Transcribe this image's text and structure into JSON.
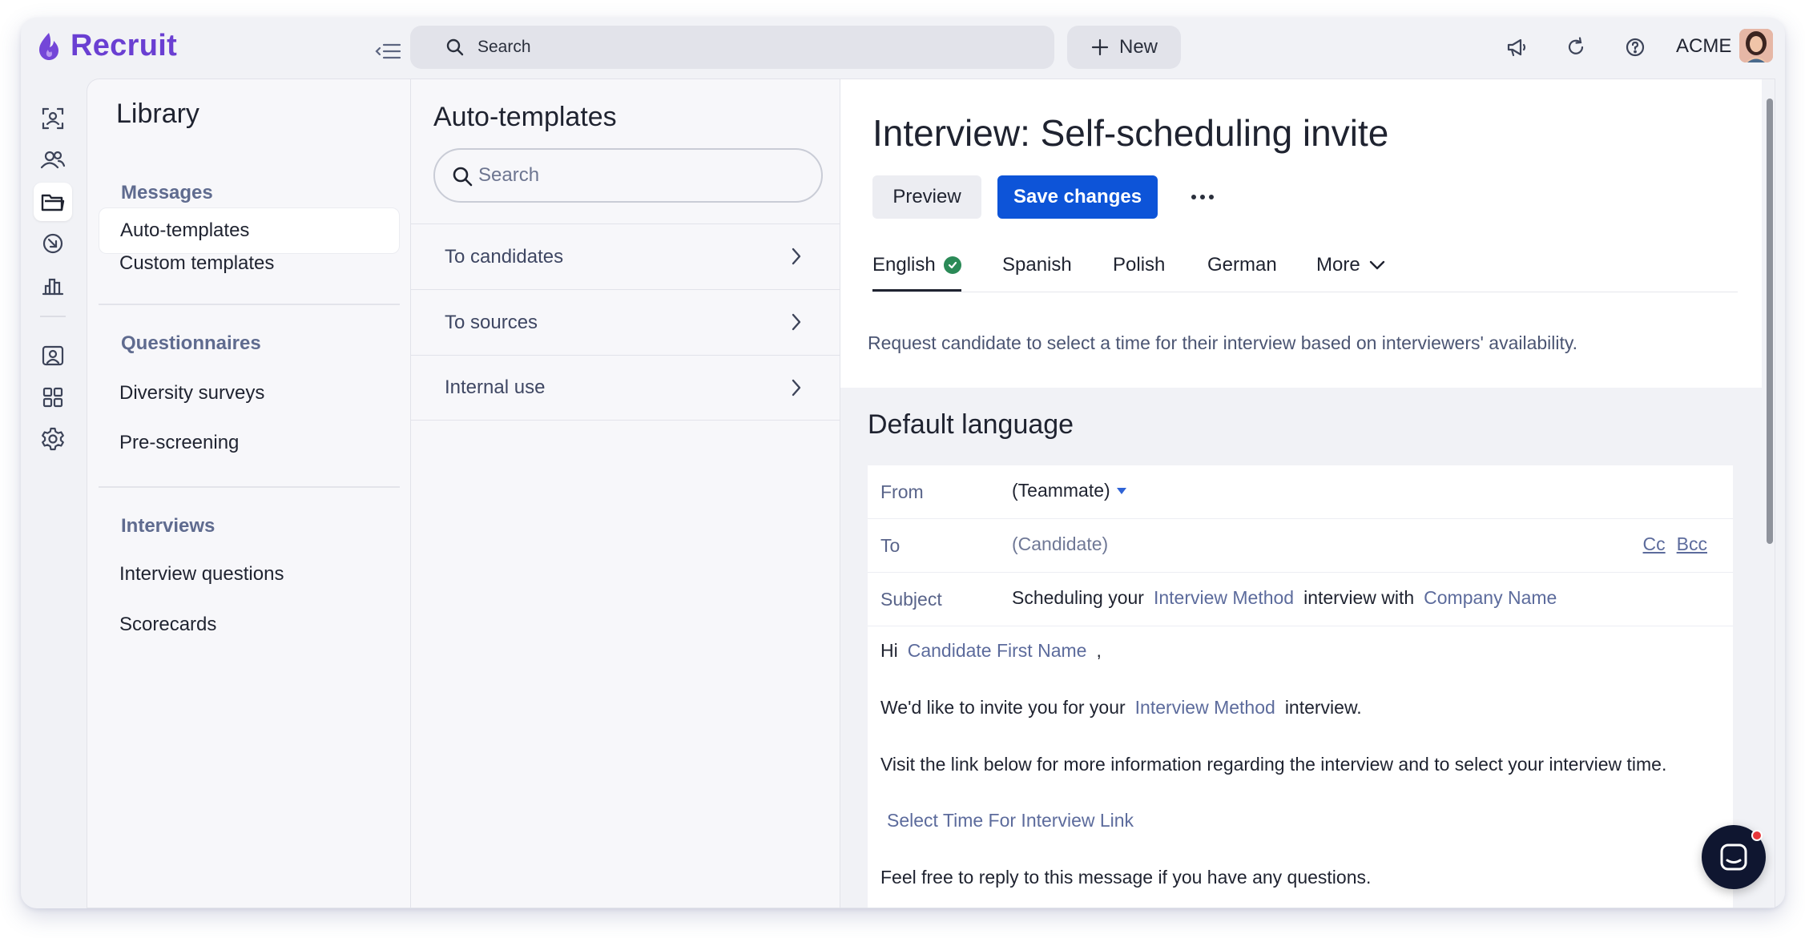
{
  "app": {
    "name": "Recruit",
    "org": "ACME"
  },
  "topbar": {
    "search_placeholder": "Search",
    "new_label": "New"
  },
  "library": {
    "title": "Library",
    "sections": [
      {
        "heading": "Messages",
        "items": [
          "Auto-templates",
          "Custom templates"
        ]
      },
      {
        "heading": "Questionnaires",
        "items": [
          "Diversity surveys",
          "Pre-screening"
        ]
      },
      {
        "heading": "Interviews",
        "items": [
          "Interview questions",
          "Scorecards"
        ]
      }
    ],
    "active_item": "Auto-templates"
  },
  "templates": {
    "title": "Auto-templates",
    "search_placeholder": "Search",
    "rows": [
      "To candidates",
      "To sources",
      "Internal use"
    ]
  },
  "detail": {
    "title": "Interview: Self-scheduling invite",
    "preview_label": "Preview",
    "save_label": "Save changes",
    "tabs": [
      "English",
      "Spanish",
      "Polish",
      "German",
      "More"
    ],
    "active_tab": "English",
    "description": "Request candidate to select a time for their interview based on interviewers' availability.",
    "default_language_title": "Default language",
    "email": {
      "from_label": "From",
      "from_value": "(Teammate)",
      "to_label": "To",
      "to_value": "(Candidate)",
      "cc_label": "Cc",
      "bcc_label": "Bcc",
      "subject_label": "Subject",
      "subject_text_1": "Scheduling your",
      "subject_var_1": "Interview Method",
      "subject_text_2": "interview with",
      "subject_var_2": "Company Name",
      "greeting": "Hi",
      "greeting_var": "Candidate First Name",
      "greeting_end": ",",
      "line1_text": "We'd like to invite you for your",
      "line1_var": "Interview Method",
      "line1_end": "interview.",
      "line2": "Visit the link below for more information regarding the interview and to select your interview time.",
      "link_var": "Select Time For Interview Link",
      "line3": "Feel free to reply to this message if you have any questions."
    }
  },
  "colors": {
    "brand": "#6a3fd2",
    "primary_button": "#0d54d8",
    "check": "#2b8a57",
    "variable_text": "#5c6b9c",
    "chat_button": "#0f1630",
    "notification_dot": "#e8363a"
  },
  "icons": [
    "logo-flame-icon",
    "collapse-sidebar-icon",
    "search-icon",
    "plus-icon",
    "megaphone-icon",
    "refresh-icon",
    "help-icon",
    "candidates-scan-icon",
    "people-icon",
    "library-folder-icon",
    "arrow-circle-icon",
    "bar-chart-icon",
    "contact-card-icon",
    "apps-grid-icon",
    "settings-gear-icon",
    "chevron-right-icon",
    "check-circle-icon",
    "chevron-down-icon",
    "caret-down-icon",
    "chat-icon"
  ]
}
